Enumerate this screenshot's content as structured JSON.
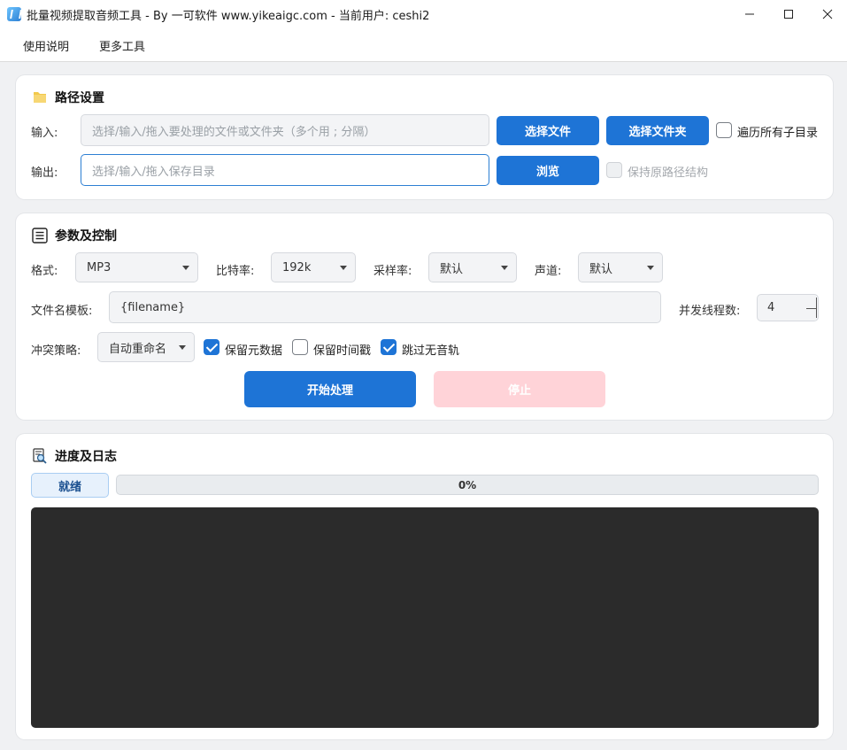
{
  "window": {
    "title": "批量视频提取音频工具 - By 一可软件 www.yikeaigc.com - 当前用户: ceshi2"
  },
  "menu": {
    "items": [
      "使用说明",
      "更多工具"
    ]
  },
  "path_settings": {
    "title": "路径设置",
    "input_label": "输入:",
    "input_placeholder": "选择/输入/拖入要处理的文件或文件夹（多个用 ; 分隔）",
    "choose_file": "选择文件",
    "choose_folder": "选择文件夹",
    "recurse_label": "遍历所有子目录",
    "recurse_checked": false,
    "output_label": "输出:",
    "output_placeholder": "选择/输入/拖入保存目录",
    "browse": "浏览",
    "keep_structure_label": "保持原路径结构",
    "keep_structure_checked": false
  },
  "params": {
    "title": "参数及控制",
    "format_label": "格式:",
    "format_value": "MP3",
    "bitrate_label": "比特率:",
    "bitrate_value": "192k",
    "samplerate_label": "采样率:",
    "samplerate_value": "默认",
    "channel_label": "声道:",
    "channel_value": "默认",
    "template_label": "文件名模板:",
    "template_value": "{filename}",
    "threads_label": "并发线程数:",
    "threads_value": "4",
    "conflict_label": "冲突策略:",
    "conflict_value": "自动重命名",
    "keep_metadata_label": "保留元数据",
    "keep_metadata_checked": true,
    "keep_timestamp_label": "保留时间戳",
    "keep_timestamp_checked": false,
    "skip_silent_label": "跳过无音轨",
    "skip_silent_checked": true,
    "start_button": "开始处理",
    "stop_button": "停止"
  },
  "progress": {
    "title": "进度及日志",
    "status": "就绪",
    "percent_text": "0%",
    "percent_value": 0,
    "colors": {
      "accent": "#1e74d6",
      "log_bg": "#2b2b2b",
      "stop_disabled": "#ffd3d8"
    }
  }
}
